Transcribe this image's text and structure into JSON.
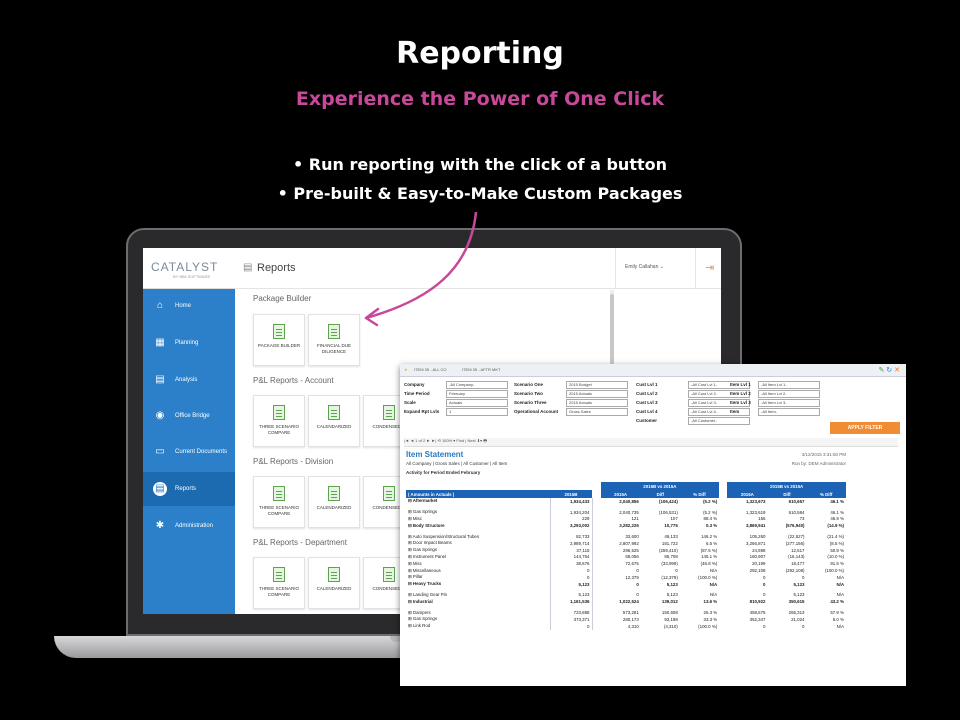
{
  "header": {
    "title": "Reporting",
    "subtitle": "Experience the Power of One Click",
    "bullets": [
      "• Run reporting with the click of a button",
      "• Pre-built & Easy-to-Make Custom Packages"
    ]
  },
  "app": {
    "logo": "CATALYST",
    "logo_sub": "BY IBM SOFTWARE",
    "page_title": "Reports",
    "user": "Emily Callahan",
    "sidebar": [
      {
        "label": "Home",
        "icon": "home-icon",
        "glyph": "⌂"
      },
      {
        "label": "Planning",
        "icon": "planning-icon",
        "glyph": "▦"
      },
      {
        "label": "Analysis",
        "icon": "analysis-icon",
        "glyph": "▤"
      },
      {
        "label": "Office Bridge",
        "icon": "office-bridge-icon",
        "glyph": "◉"
      },
      {
        "label": "Current Documents",
        "icon": "documents-icon",
        "glyph": "▭"
      },
      {
        "label": "Reports",
        "icon": "reports-icon",
        "glyph": "▤"
      },
      {
        "label": "Administration",
        "icon": "administration-icon",
        "glyph": "✱"
      }
    ],
    "sections": [
      {
        "title": "Package Builder",
        "cards": [
          "PACKAGE BUILDER",
          "FINANCIAL DUE DILIGENCE"
        ]
      },
      {
        "title": "P&L Reports - Account",
        "cards": [
          "THREE SCENARIO COMPARE",
          "CALENDARIZED",
          "CONDENSED V"
        ]
      },
      {
        "title": "P&L Reports - Division",
        "cards": [
          "THREE SCENARIO COMPARE",
          "CALENDARIZED",
          "CONDENSED V"
        ]
      },
      {
        "title": "P&L Reports - Department",
        "cards": [
          "THREE SCENARIO COMPARE",
          "CALENDARIZED",
          "CONDENSED V"
        ]
      }
    ]
  },
  "report": {
    "tabs": [
      "ITEM 35 - ALL CO",
      "ITEM 35 - AFTR MKT"
    ],
    "filters": [
      {
        "label": "Company",
        "value": "-All Company-"
      },
      {
        "label": "Time Period",
        "value": "February"
      },
      {
        "label": "Scale",
        "value": "Actuals"
      },
      {
        "label": "Expand Rpt Lvls",
        "value": "1"
      },
      {
        "label": "Scenario One",
        "value": "2015 Budget"
      },
      {
        "label": "Scenario Two",
        "value": "2015 Actuals"
      },
      {
        "label": "Scenario Three",
        "value": "2015 Actuals"
      },
      {
        "label": "Operational Account",
        "value": "Gross Sales"
      },
      {
        "label": "Cust Lvl 1",
        "value": "-All Cust Lvl 1-"
      },
      {
        "label": "Cust Lvl 2",
        "value": "-All Cust Lvl 2-"
      },
      {
        "label": "Cust Lvl 3",
        "value": "-All Cust Lvl 3-"
      },
      {
        "label": "Cust Lvl 4",
        "value": "-All Cust Lvl 4-"
      },
      {
        "label": "Customer",
        "value": "-All Customer-"
      },
      {
        "label": "Item Lvl 1",
        "value": "-All Item Lvl 1-"
      },
      {
        "label": "Item Lvl 2",
        "value": "-All Item Lvl 2-"
      },
      {
        "label": "Item Lvl 3",
        "value": "-All Item Lvl 3-"
      },
      {
        "label": "Item",
        "value": "-All Item-"
      }
    ],
    "apply_label": "APPLY FILTER",
    "toolbar": "|◄ ◄  1  of 2 ► ►|   ⟲   100%  ▾      Find | Next    ⬇▾  🖶",
    "heading": "Item Statement",
    "date": "3/12/2015 3:31:50 PM",
    "sub1": "All Company | Gross Sales | All Customer | All Item",
    "sub2": "Activity for Period Ended February",
    "runby": "Run by: DEM Administrator",
    "group_headers": [
      "2015B vs 2015A",
      "2015B vs 2015A"
    ],
    "col_headers": [
      "( Amounts in Actuals )",
      "2015B",
      "2015A",
      "Diff",
      "% Diff",
      "2015A",
      "Diff",
      "% Diff"
    ],
    "rows": [
      {
        "label": "⊟  Aftermarket",
        "vals": [
          "1,934,433",
          "2,040,856",
          "(106,424)",
          "(5.2 %)",
          "1,323,673",
          "610,657",
          "46.1 %"
        ],
        "bold": true
      },
      {
        "label": "",
        "vals": [
          "",
          "",
          "",
          "",
          "",
          "",
          ""
        ],
        "spacer": true
      },
      {
        "label": "    ⊞  Gas Springs",
        "vals": [
          "1,934,204",
          "2,040,735",
          "(106,531)",
          "(5.2 %)",
          "1,323,619",
          "610,584",
          "46.1 %"
        ]
      },
      {
        "label": "    ⊞  Misc",
        "vals": [
          "229",
          "121",
          "107",
          "88.4 %",
          "156",
          "73",
          "46.9 %"
        ]
      },
      {
        "label": "⊟  Body Structure",
        "vals": [
          "3,293,002",
          "3,282,226",
          "10,775",
          "0.3 %",
          "3,869,941",
          "(576,940)",
          "(14.9 %)"
        ],
        "bold": true
      },
      {
        "label": "",
        "vals": [
          "",
          "",
          "",
          "",
          "",
          "",
          ""
        ],
        "spacer": true
      },
      {
        "label": "    ⊞  Auto Suspension/Structural Tubes",
        "vals": [
          "82,733",
          "33,600",
          "49,133",
          "146.2 %",
          "105,260",
          "(22,527)",
          "(21.4 %)"
        ]
      },
      {
        "label": "    ⊞  Door Impact Beams",
        "vals": [
          "2,989,714",
          "2,807,992",
          "181,722",
          "6.5 %",
          "3,266,871",
          "(277,156)",
          "(8.5 %)"
        ]
      },
      {
        "label": "    ⊞  Gas Springs",
        "vals": [
          "37,115",
          "296,525",
          "(259,410)",
          "(87.5 %)",
          "24,598",
          "12,517",
          "50.9 %"
        ]
      },
      {
        "label": "    ⊞  Instrument Panel",
        "vals": [
          "144,764",
          "59,056",
          "85,708",
          "145.1 %",
          "160,907",
          "(16,143)",
          "(10.0 %)"
        ]
      },
      {
        "label": "    ⊞  Misc",
        "vals": [
          "38,676",
          "72,675",
          "(33,999)",
          "(46.8 %)",
          "20,199",
          "18,477",
          "91.5 %"
        ]
      },
      {
        "label": "    ⊞  Miscellaneous",
        "vals": [
          "0",
          "0",
          "0",
          "N/A",
          "292,108",
          "(292,108)",
          "(100.0 %)"
        ]
      },
      {
        "label": "    ⊞  Pillar",
        "vals": [
          "0",
          "12,379",
          "(12,379)",
          "(100.0 %)",
          "0",
          "0",
          "N/A"
        ]
      },
      {
        "label": "⊟  Heavy Trucks",
        "vals": [
          "5,123",
          "0",
          "5,123",
          "N/A",
          "0",
          "5,123",
          "N/A"
        ],
        "bold": true
      },
      {
        "label": "",
        "vals": [
          "",
          "",
          "",
          "",
          "",
          "",
          ""
        ],
        "spacer": true
      },
      {
        "label": "    ⊞  Landing Gear Pin",
        "vals": [
          "5,123",
          "0",
          "5,123",
          "N/A",
          "0",
          "5,123",
          "N/A"
        ]
      },
      {
        "label": "⊟  Industrial",
        "vals": [
          "1,161,536",
          "1,022,524",
          "139,012",
          "13.6 %",
          "810,922",
          "350,615",
          "43.2 %"
        ],
        "bold": true
      },
      {
        "label": "",
        "vals": [
          "",
          "",
          "",
          "",
          "",
          "",
          ""
        ],
        "spacer": true
      },
      {
        "label": "    ⊞  Dampers",
        "vals": [
          "723,888",
          "573,281",
          "150,608",
          "26.3 %",
          "458,575",
          "265,313",
          "57.9 %"
        ]
      },
      {
        "label": "    ⊞  Gas Springs",
        "vals": [
          "373,371",
          "280,173",
          "93,198",
          "33.3 %",
          "352,347",
          "21,024",
          "6.0 %"
        ]
      },
      {
        "label": "    ⊞  Link Rod",
        "vals": [
          "0",
          "4,310",
          "(4,310)",
          "(100.0 %)",
          "0",
          "0",
          "N/A"
        ]
      }
    ]
  }
}
